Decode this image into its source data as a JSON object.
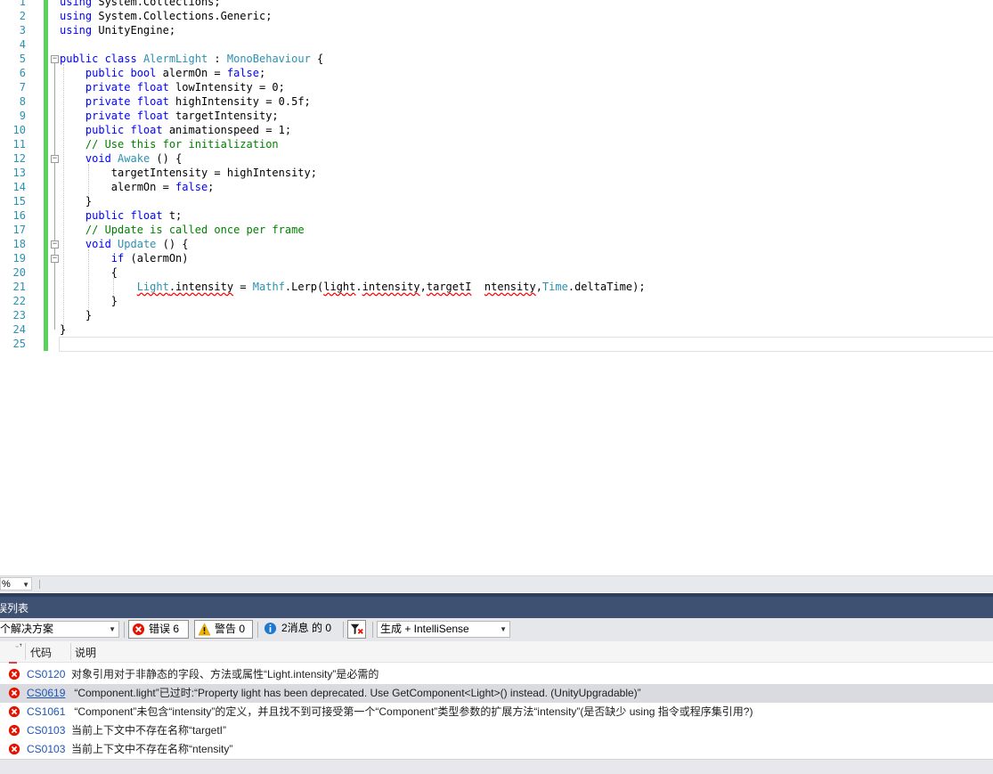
{
  "editor": {
    "lines": [
      {
        "n": "1",
        "segs": [
          {
            "c": "kw",
            "t": "using"
          },
          {
            "c": "",
            "t": " System.Collections;"
          }
        ]
      },
      {
        "n": "2",
        "segs": [
          {
            "c": "kw",
            "t": "using"
          },
          {
            "c": "",
            "t": " System.Collections.Generic;"
          }
        ]
      },
      {
        "n": "3",
        "segs": [
          {
            "c": "kw",
            "t": "using"
          },
          {
            "c": "",
            "t": " UnityEngine;"
          }
        ]
      },
      {
        "n": "4",
        "segs": []
      },
      {
        "n": "5",
        "segs": [
          {
            "c": "kw",
            "t": "public class"
          },
          {
            "c": "",
            "t": " "
          },
          {
            "c": "ty",
            "t": "AlermLight"
          },
          {
            "c": "",
            "t": " : "
          },
          {
            "c": "ty",
            "t": "MonoBehaviour"
          },
          {
            "c": "",
            "t": " {"
          }
        ]
      },
      {
        "n": "6",
        "segs": [
          {
            "c": "",
            "t": "    "
          },
          {
            "c": "kw",
            "t": "public bool"
          },
          {
            "c": "",
            "t": " alermOn = "
          },
          {
            "c": "kw",
            "t": "false"
          },
          {
            "c": "",
            "t": ";"
          }
        ]
      },
      {
        "n": "7",
        "segs": [
          {
            "c": "",
            "t": "    "
          },
          {
            "c": "kw",
            "t": "private float"
          },
          {
            "c": "",
            "t": " lowIntensity = 0;"
          }
        ]
      },
      {
        "n": "8",
        "segs": [
          {
            "c": "",
            "t": "    "
          },
          {
            "c": "kw",
            "t": "private float"
          },
          {
            "c": "",
            "t": " highIntensity = 0.5f;"
          }
        ]
      },
      {
        "n": "9",
        "segs": [
          {
            "c": "",
            "t": "    "
          },
          {
            "c": "kw",
            "t": "private float"
          },
          {
            "c": "",
            "t": " targetIntensity;"
          }
        ]
      },
      {
        "n": "10",
        "segs": [
          {
            "c": "",
            "t": "    "
          },
          {
            "c": "kw",
            "t": "public float"
          },
          {
            "c": "",
            "t": " animationspeed = 1;"
          }
        ]
      },
      {
        "n": "11",
        "segs": [
          {
            "c": "",
            "t": "    "
          },
          {
            "c": "cm",
            "t": "// Use this for initialization"
          }
        ]
      },
      {
        "n": "12",
        "segs": [
          {
            "c": "",
            "t": "    "
          },
          {
            "c": "kw",
            "t": "void"
          },
          {
            "c": "",
            "t": " "
          },
          {
            "c": "ty",
            "t": "Awake"
          },
          {
            "c": "",
            "t": " () {"
          }
        ]
      },
      {
        "n": "13",
        "segs": [
          {
            "c": "",
            "t": "        targetIntensity = highIntensity;"
          }
        ]
      },
      {
        "n": "14",
        "segs": [
          {
            "c": "",
            "t": "        alermOn = "
          },
          {
            "c": "kw",
            "t": "false"
          },
          {
            "c": "",
            "t": ";"
          }
        ]
      },
      {
        "n": "15",
        "segs": [
          {
            "c": "",
            "t": "    }"
          }
        ]
      },
      {
        "n": "16",
        "segs": [
          {
            "c": "",
            "t": "    "
          },
          {
            "c": "kw",
            "t": "public float"
          },
          {
            "c": "",
            "t": " t;"
          }
        ]
      },
      {
        "n": "17",
        "segs": [
          {
            "c": "",
            "t": "    "
          },
          {
            "c": "cm",
            "t": "// Update is called once per frame"
          }
        ]
      },
      {
        "n": "18",
        "segs": [
          {
            "c": "",
            "t": "    "
          },
          {
            "c": "kw",
            "t": "void"
          },
          {
            "c": "",
            "t": " "
          },
          {
            "c": "ty",
            "t": "Update"
          },
          {
            "c": "",
            "t": " () {"
          }
        ]
      },
      {
        "n": "19",
        "segs": [
          {
            "c": "",
            "t": "        "
          },
          {
            "c": "kw",
            "t": "if"
          },
          {
            "c": "",
            "t": " (alermOn)"
          }
        ]
      },
      {
        "n": "20",
        "segs": [
          {
            "c": "",
            "t": "        {"
          }
        ]
      },
      {
        "n": "21",
        "segs": [
          {
            "c": "",
            "t": "            "
          },
          {
            "c": "ty sq",
            "t": "Light"
          },
          {
            "c": "sq",
            "t": ".intensity"
          },
          {
            "c": "",
            "t": " = "
          },
          {
            "c": "ty",
            "t": "Mathf"
          },
          {
            "c": "",
            "t": ".Lerp("
          },
          {
            "c": "sq",
            "t": "light"
          },
          {
            "c": "",
            "t": "."
          },
          {
            "c": "sq",
            "t": "intensity"
          },
          {
            "c": "",
            "t": ","
          },
          {
            "c": "sq",
            "t": "targetI"
          },
          {
            "c": "",
            "t": "  "
          },
          {
            "c": "sq",
            "t": "ntensity"
          },
          {
            "c": "",
            "t": ","
          },
          {
            "c": "ty",
            "t": "Time"
          },
          {
            "c": "",
            "t": ".deltaTime);"
          }
        ]
      },
      {
        "n": "22",
        "segs": [
          {
            "c": "",
            "t": "        }"
          }
        ]
      },
      {
        "n": "23",
        "segs": [
          {
            "c": "",
            "t": "    }"
          }
        ]
      },
      {
        "n": "24",
        "segs": [
          {
            "c": "",
            "t": "}"
          }
        ]
      },
      {
        "n": "25",
        "segs": []
      }
    ]
  },
  "zoom": {
    "value": "%"
  },
  "error_list": {
    "title": "误列表",
    "scope": "个解决方案",
    "errors_label": "错误 6",
    "warnings_label": "警告 0",
    "messages_label": "2消息 的 0",
    "build_filter": "生成 + IntelliSense",
    "col_code": "代码",
    "col_desc": "说明",
    "rows": [
      {
        "code": "CS0120",
        "desc": "对象引用对于非静态的字段、方法或属性“Light.intensity”是必需的"
      },
      {
        "code": "CS0619",
        "desc": " “Component.light”已过时:“Property light has been deprecated. Use GetComponent<Light>() instead. (UnityUpgradable)”"
      },
      {
        "code": "CS1061",
        "desc": " “Component”未包含“intensity”的定义，并且找不到可接受第一个“Component”类型参数的扩展方法“intensity”(是否缺少 using 指令或程序集引用?)"
      },
      {
        "code": "CS0103",
        "desc": "当前上下文中不存在名称“targetI”"
      },
      {
        "code": "CS0103",
        "desc": "当前上下文中不存在名称“ntensity”"
      }
    ]
  },
  "colors": {
    "keyword": "#0000ff",
    "type": "#2b91af",
    "comment": "#008000",
    "change_bar": "#5ad15a",
    "panel_title_bg": "#3f5173",
    "error_red": "#e51400"
  }
}
